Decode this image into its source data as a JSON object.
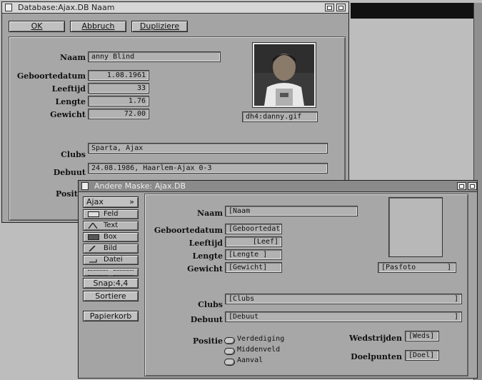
{
  "window1": {
    "title": "Database:Ajax.DB  Naam",
    "buttons": {
      "ok": "OK",
      "cancel": "Abbruch",
      "duplicate": "Dupliziere"
    },
    "labels": {
      "naam": "Naam",
      "geboortedatum": "Geboortedatum",
      "leeftijd": "Leeftijd",
      "lengte": "Lengte",
      "gewicht": "Gewicht",
      "clubs": "Clubs",
      "debuut": "Debuut",
      "positie": "Positie"
    },
    "values": {
      "naam": "anny Blind",
      "geboortedatum": "1.08.1961",
      "leeftijd": "33",
      "lengte": "1.76",
      "gewicht": "72.00",
      "clubs": "Sparta, Ajax",
      "debuut": "24.08.1986, Haarlem-Ajax 0-3",
      "photo_file": "dh4:danny.gif"
    }
  },
  "window2": {
    "title": "Andere Maske: Ajax.DB",
    "toolbox": {
      "header": "Ajax",
      "header_arrow": "»",
      "items": [
        "Feld",
        "Text",
        "Box",
        "Bild",
        "Datei"
      ],
      "snap": "Snap:4,4",
      "sort": "Sortiere",
      "trash": "Papierkorb"
    },
    "labels": {
      "naam": "Naam",
      "geboortedatum": "Geboortedatum",
      "leeftijd": "Leeftijd",
      "lengte": "Lengte",
      "gewicht": "Gewicht",
      "clubs": "Clubs",
      "debuut": "Debuut",
      "positie": "Positie",
      "wedstrijden": "Wedstrijden",
      "doelpunten": "Doelpunten"
    },
    "placeholders": {
      "naam": "[Naam",
      "geboortedatum": "[Geboortedat",
      "leeftijd": "[Leef]",
      "lengte": "[Lengte ]",
      "gewicht": "[Gewicht]",
      "pasfoto": "[Pasfoto",
      "pasfoto_end": "]",
      "clubs": "[Clubs",
      "clubs_end": "]",
      "debuut": "[Debuut",
      "debuut_end": "]",
      "wedstrijden": "[Weds]",
      "doelpunten": "[Doel]"
    },
    "radio_options": [
      "Verdediging",
      "Middenveld",
      "Aanval"
    ]
  }
}
